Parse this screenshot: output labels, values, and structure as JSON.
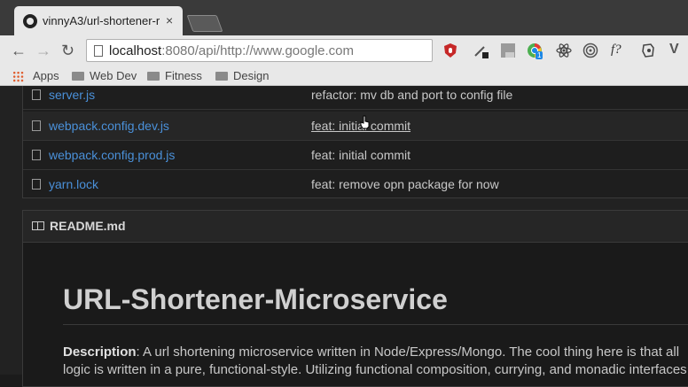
{
  "browser": {
    "tab": {
      "title": "vinnyA3/url-shortener-r",
      "close": "×"
    },
    "toolbar": {
      "back": "←",
      "forward": "→",
      "reload": "↻"
    },
    "address": {
      "host": "localhost",
      "rest": ":8080/api/http://www.google.com"
    },
    "bookmarks": [
      {
        "label": "Apps"
      },
      {
        "label": "Web Dev"
      },
      {
        "label": "Fitness"
      },
      {
        "label": "Design"
      }
    ],
    "extensions": [
      {
        "name": "ublock-icon"
      },
      {
        "name": "eyedropper-icon"
      },
      {
        "name": "es-extension-icon"
      },
      {
        "name": "chrome-extension-icon",
        "badge": "1"
      },
      {
        "name": "react-devtools-icon"
      },
      {
        "name": "target-icon"
      },
      {
        "name": "fx-icon",
        "text": "f?"
      },
      {
        "name": "evernote-icon"
      },
      {
        "name": "vue-icon",
        "text": "V"
      }
    ]
  },
  "files": [
    {
      "name": "server.js",
      "commit": "refactor: mv db and port to config file"
    },
    {
      "name": "webpack.config.dev.js",
      "commit": "feat: initial commit"
    },
    {
      "name": "webpack.config.prod.js",
      "commit": "feat: initial commit"
    },
    {
      "name": "yarn.lock",
      "commit": "feat: remove opn package for now"
    }
  ],
  "readme": {
    "filename": "README.md",
    "heading": "URL-Shortener-Microservice",
    "description_label": "Description",
    "description_line1": ": A url shortening microservice written in Node/Express/Mongo. The cool thing here is that all",
    "description_line2": "logic is written in a pure, functional-style. Utilizing functional composition, currying, and monadic interfaces"
  }
}
